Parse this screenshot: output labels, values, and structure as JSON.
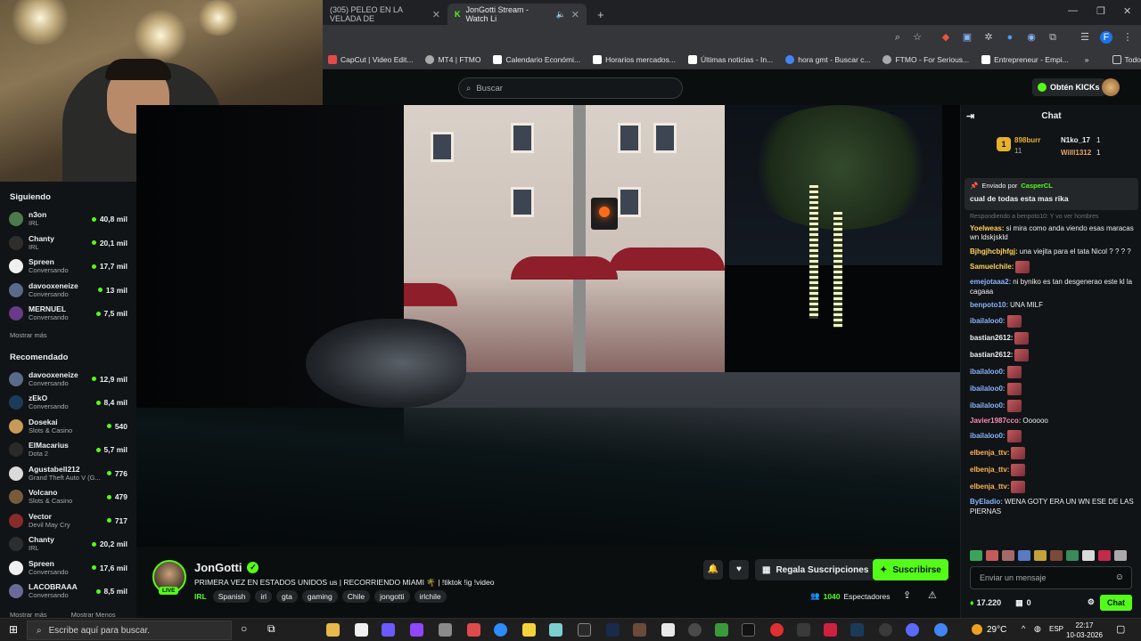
{
  "browser": {
    "tabs": [
      {
        "title": "(305) PELEO EN LA VELADA DE",
        "active": false
      },
      {
        "title": "JonGotti Stream - Watch Li",
        "active": true
      }
    ],
    "new_tab": "+",
    "bookmarks": [
      "CapCut | Video Edit...",
      "MT4 | FTMO",
      "Calendario Económi...",
      "Horarios mercados...",
      "Últimas noticias - In...",
      "hora gmt - Buscar c...",
      "FTMO - For Serious...",
      "Entrepreneur - Empi...",
      "Todos los favoritos"
    ]
  },
  "header": {
    "search_placeholder": "Buscar",
    "get_kicks": "Obtén KICKs"
  },
  "sidebar": {
    "following_title": "Siguiendo",
    "following": [
      {
        "name": "n3on",
        "category": "IRL",
        "viewers": "40,8 mil",
        "color": "#4c7a4c"
      },
      {
        "name": "Chanty",
        "category": "IRL",
        "viewers": "20,1 mil",
        "color": "#2e2e2e"
      },
      {
        "name": "Spreen",
        "category": "Conversando",
        "viewers": "17,7 mil",
        "color": "#f0f0f0"
      },
      {
        "name": "davooxeneize",
        "category": "Conversando",
        "viewers": "13 mil",
        "color": "#5a6a8a"
      },
      {
        "name": "MERNUEL",
        "category": "Conversando",
        "viewers": "7,5 mil",
        "color": "#6a3a8a"
      }
    ],
    "show_more_1": "Mostrar más",
    "recommended_title": "Recomendado",
    "recommended": [
      {
        "name": "davooxeneize",
        "category": "Conversando",
        "viewers": "12,9 mil",
        "color": "#5a6a8a"
      },
      {
        "name": "zEkO",
        "category": "Conversando",
        "viewers": "8,4 mil",
        "color": "#1e3a5a"
      },
      {
        "name": "Dosekai",
        "category": "Slots & Casino",
        "viewers": "540",
        "color": "#c89a5a"
      },
      {
        "name": "ElMacarius",
        "category": "Dota 2",
        "viewers": "5,7 mil",
        "color": "#2a2a2a"
      },
      {
        "name": "Agustabell212",
        "category": "Grand Theft Auto V (G...",
        "viewers": "776",
        "color": "#dadada"
      },
      {
        "name": "Volcano",
        "category": "Slots & Casino",
        "viewers": "479",
        "color": "#7a5a3a"
      },
      {
        "name": "Vector",
        "category": "Devil May Cry",
        "viewers": "717",
        "color": "#8a2a2a"
      },
      {
        "name": "Chanty",
        "category": "IRL",
        "viewers": "20,2 mil",
        "color": "#2e2e2e"
      },
      {
        "name": "Spreen",
        "category": "Conversando",
        "viewers": "17,6 mil",
        "color": "#f0f0f0"
      },
      {
        "name": "LACOBRAAA",
        "category": "Conversando",
        "viewers": "8,5 mil",
        "color": "#6a6a9a"
      }
    ],
    "show_more_2": "Mostrar más",
    "show_less": "Mostrar Menos"
  },
  "stream": {
    "channel": "JonGotti",
    "live": "LIVE",
    "title": "PRIMERA VEZ EN ESTADOS UNIDOS us | RECORRIENDO MIAMI 🌴 | !tiktok !ig !video",
    "category": "IRL",
    "tags": [
      "Spanish",
      "irl",
      "gta",
      "gaming",
      "Chile",
      "jongotti",
      "irlchile"
    ],
    "gift_label": "Regala Suscripciones",
    "subscribe_label": "Suscribirse",
    "viewers": "1040",
    "viewers_label": "Espectadores"
  },
  "chat": {
    "title": "Chat",
    "leaders": [
      {
        "name": "898burr",
        "count": "11"
      },
      {
        "name": "N1ko_17",
        "count": "1"
      },
      {
        "name": "Willl1312",
        "count": "1"
      }
    ],
    "pinned_by_label": "Enviado por",
    "pinned_by": "CasperCL",
    "pinned_message": "cual de todas esta mas rika",
    "reply_note": "Respondiendo a benpoto10: Y vo ver hombres",
    "messages": [
      {
        "user": "Yoelweas:",
        "color": "#ffd25a",
        "text": "si mira como anda viendo esas maracas wn ldskjskld",
        "emote": false
      },
      {
        "user": "Bjhgjhcbjhfgj:",
        "color": "#ffd25a",
        "text": "una viejita para el tata Nicol ? ? ? ?",
        "emote": false
      },
      {
        "user": "Samuelchile:",
        "color": "#ffd25a",
        "text": "",
        "emote": true
      },
      {
        "user": "emejotaaa2:",
        "color": "#8ab4ff",
        "text": "ni byniko es tan desgenerao este kl la cagaaa",
        "emote": false
      },
      {
        "user": "benpoto10:",
        "color": "#8ab4ff",
        "text": "UNA MILF",
        "emote": false
      },
      {
        "user": "ibailaloo0:",
        "color": "#8ab4ff",
        "text": "",
        "emote": true
      },
      {
        "user": "bastian2612:",
        "color": "#efeff1",
        "text": "",
        "emote": true
      },
      {
        "user": "bastian2612:",
        "color": "#efeff1",
        "text": "",
        "emote": true
      },
      {
        "user": "ibailaloo0:",
        "color": "#8ab4ff",
        "text": "",
        "emote": true
      },
      {
        "user": "ibailaloo0:",
        "color": "#8ab4ff",
        "text": "",
        "emote": true
      },
      {
        "user": "ibailaloo0:",
        "color": "#8ab4ff",
        "text": "",
        "emote": true
      },
      {
        "user": "Javier1987cco:",
        "color": "#ff8ab4",
        "text": "Oooooo",
        "emote": false
      },
      {
        "user": "ibailaloo0:",
        "color": "#8ab4ff",
        "text": "",
        "emote": true
      },
      {
        "user": "elbenja_ttv:",
        "color": "#ffb45a",
        "text": "",
        "emote": true
      },
      {
        "user": "elbenja_ttv:",
        "color": "#ffb45a",
        "text": "",
        "emote": true
      },
      {
        "user": "elbenja_ttv:",
        "color": "#ffb45a",
        "text": "",
        "emote": true
      },
      {
        "user": "ByEladio:",
        "color": "#8ab4ff",
        "text": "WENA GOTY ERA UN WN ESE DE LAS PIERNAS",
        "emote": false
      }
    ],
    "input_placeholder": "Enviar un mensaje",
    "kicks_balance": "17.220",
    "gift_count": "0",
    "send_label": "Chat"
  },
  "taskbar": {
    "search_placeholder": "Escribe aquí para buscar.",
    "temperature": "29°C",
    "lang": "ESP",
    "time": "22:17",
    "date": "10-03-2026"
  },
  "colors": {
    "accent": "#53fc18",
    "background": "#0b0e0f",
    "panel": "#111416"
  }
}
